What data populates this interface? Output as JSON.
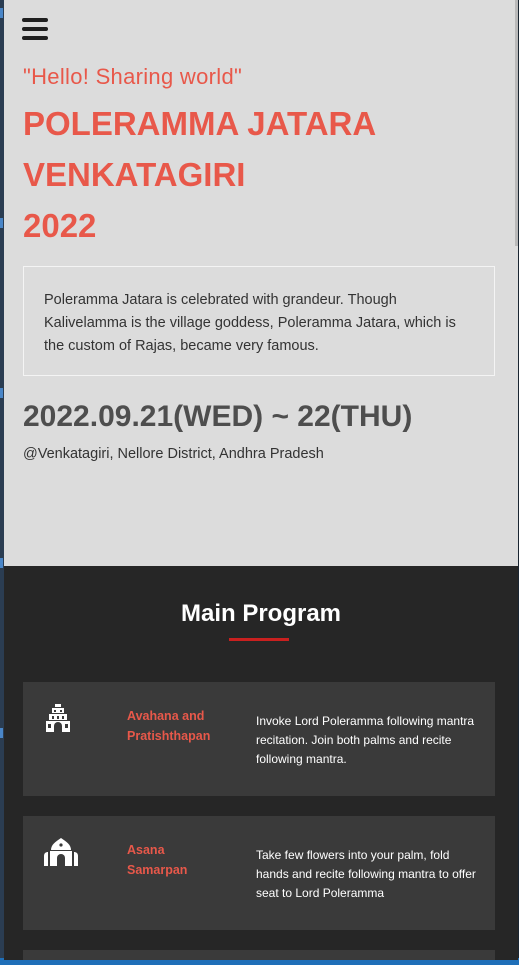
{
  "header": {
    "menu_icon": "hamburger-menu-icon",
    "greeting": "\"Hello! Sharing world\"",
    "title_lines": [
      "POLERAMMA JATARA",
      "VENKATAGIRI",
      "2022"
    ]
  },
  "intro": {
    "description": "Poleramma Jatara is celebrated with grandeur. Though Kalivelamma is the village goddess, Poleramma Jatara, which is the custom of Rajas, became very famous."
  },
  "event": {
    "date": "2022.09.21(WED) ~ 22(THU)",
    "location": "@Venkatagiri, Nellore District, Andhra Pradesh"
  },
  "program": {
    "title": "Main Program",
    "items": [
      {
        "icon": "temple-gopuram-icon",
        "name": "Avahana and Pratishthapan",
        "text": "Invoke Lord Poleramma following mantra recitation. Join both palms and recite following mantra."
      },
      {
        "icon": "shrine-icon",
        "name": "Asana Samarpan",
        "text": "Take few flowers into your palm, fold hands and recite following mantra to offer seat to Lord Poleramma"
      }
    ]
  },
  "colors": {
    "accent": "#e8584a",
    "rule": "#c9201f",
    "hero_bg": "#dcdcdc",
    "program_bg": "#262626",
    "card_bg": "#3a3a3a"
  }
}
